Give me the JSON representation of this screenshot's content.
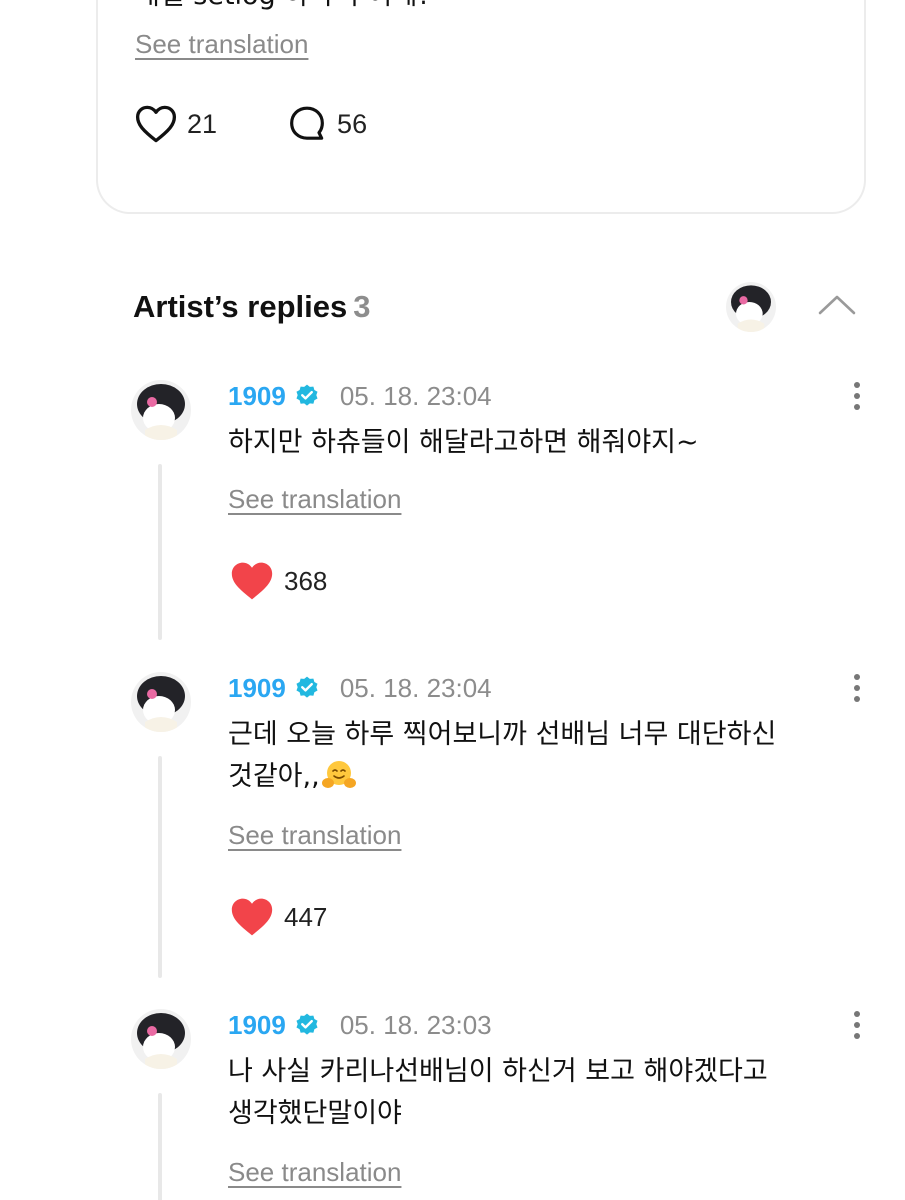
{
  "post": {
    "text": "매일 setlog 하나씩 어때?",
    "translate_label": "See translation",
    "like_count": "21",
    "comment_count": "56"
  },
  "section": {
    "title": "Artist’s replies",
    "count": "3"
  },
  "replies": [
    {
      "name": "1909",
      "time": "05. 18. 23:04",
      "text": "하지만 하츄들이 해달라고하면 해줘야지~",
      "translate_label": "See translation",
      "likes": "368"
    },
    {
      "name": "1909",
      "time": "05. 18. 23:04",
      "text_line1": "근데 오늘 하루 찍어보니까 선배님 너무 대단하신",
      "text_line2": "것같아,,",
      "emoji": "hugging-face-emoji",
      "translate_label": "See translation",
      "likes": "447"
    },
    {
      "name": "1909",
      "time": "05. 18. 23:03",
      "text_line1": "나 사실 카리나선배님이 하신거 보고 해야겠다고",
      "text_line2": "생각했단말이야",
      "translate_label": "See translation"
    }
  ],
  "colors": {
    "artist_name": "#2aa7f2",
    "verified_badge": "#22b8e0",
    "heart_liked": "#f2444a",
    "muted_text": "#8a8a8a",
    "thread_line": "#e8e8e8"
  }
}
